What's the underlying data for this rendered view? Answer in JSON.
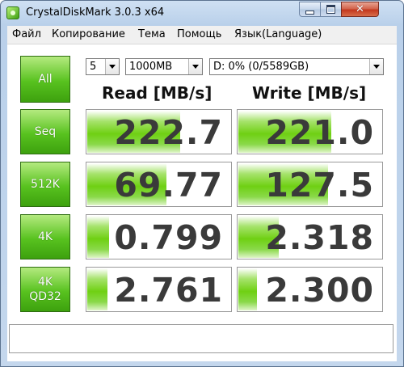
{
  "window": {
    "title": "CrystalDiskMark 3.0.3 x64",
    "accent": "#5ac221"
  },
  "icons": {
    "app": "app-icon",
    "minimize": "minimize-icon",
    "maximize": "maximize-icon",
    "close": "close-icon",
    "dropdown": "chevron-down-icon"
  },
  "menu": [
    "Файл",
    "Копирование",
    "Тема",
    "Помощь",
    "Язык(Language)"
  ],
  "controls": {
    "all_label": "All",
    "count": "5",
    "size": "1000MB",
    "drive": "D: 0% (0/5589GB)"
  },
  "headers": {
    "read": "Read [MB/s]",
    "write": "Write [MB/s]"
  },
  "rows": [
    {
      "label": "Seq",
      "label2": "",
      "read": "222.7",
      "write": "221.0",
      "read_fill": 0.64,
      "write_fill": 0.64
    },
    {
      "label": "512K",
      "label2": "",
      "read": "69.77",
      "write": "127.5",
      "read_fill": 0.55,
      "write_fill": 0.62
    },
    {
      "label": "4K",
      "label2": "",
      "read": "0.799",
      "write": "2.318",
      "read_fill": 0.15,
      "write_fill": 0.28
    },
    {
      "label": "4K",
      "label2": "QD32",
      "read": "2.761",
      "write": "2.300",
      "read_fill": 0.14,
      "write_fill": 0.13
    }
  ],
  "comment": ""
}
